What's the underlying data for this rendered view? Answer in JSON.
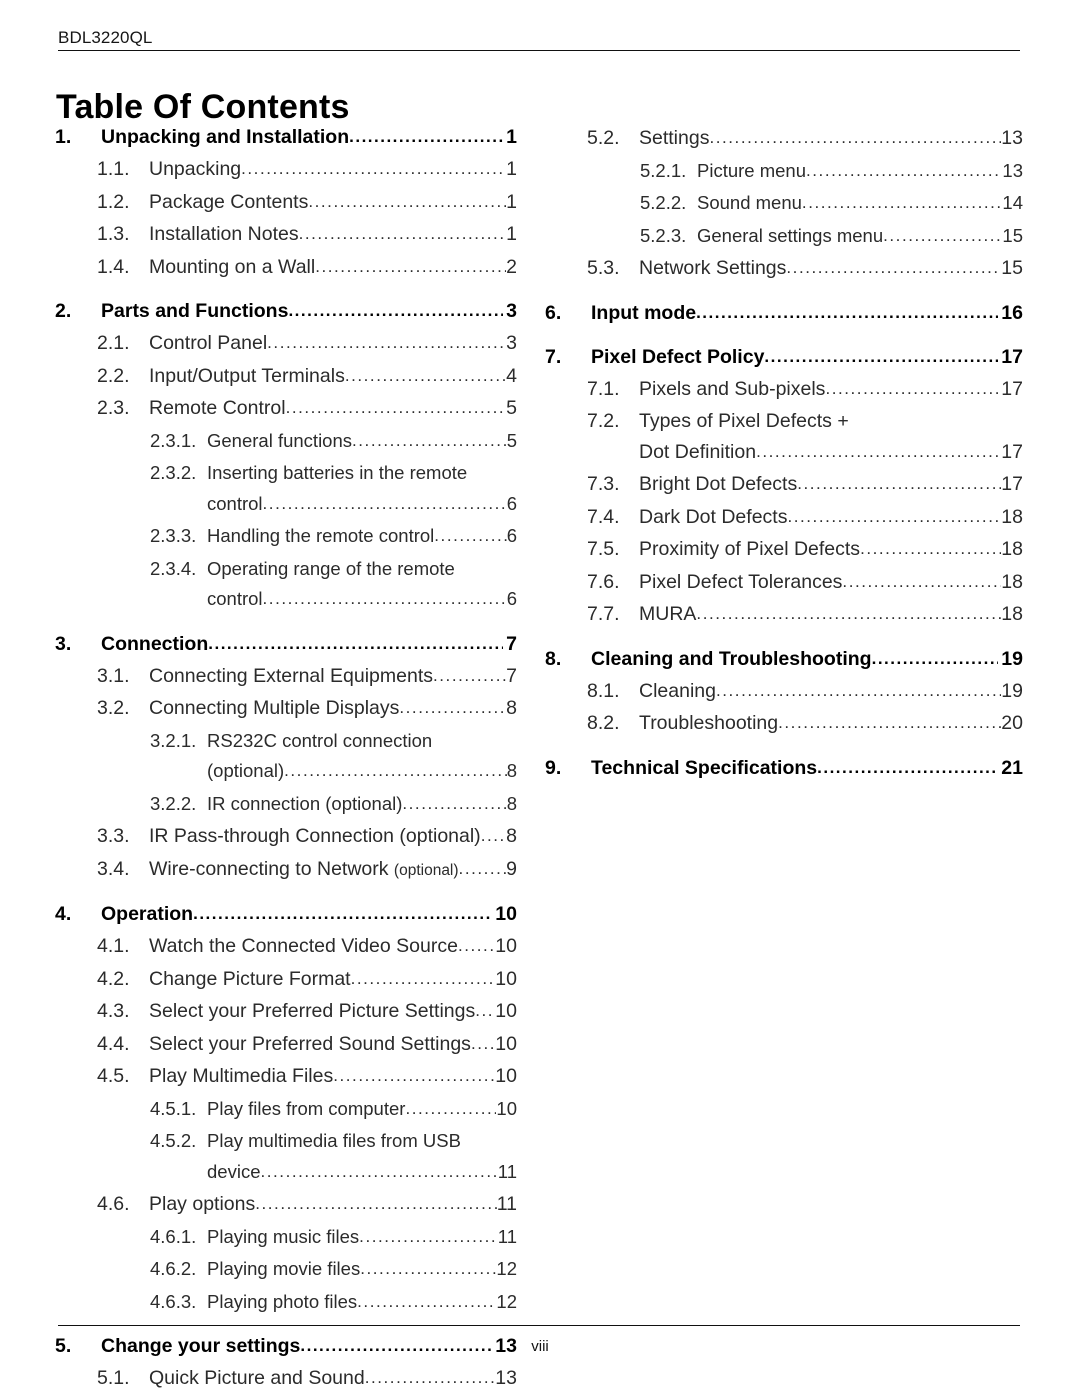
{
  "header": {
    "model": "BDL3220QL"
  },
  "title": "Table Of Contents",
  "footer": {
    "page_number": "viii"
  },
  "leader_dots": "................................................................................................................................",
  "columns": {
    "left": [
      {
        "level": 1,
        "number": "1.",
        "title": "Unpacking and Installation",
        "page": "1"
      },
      {
        "level": 2,
        "number": "1.1.",
        "title": "Unpacking",
        "page": "1"
      },
      {
        "level": 2,
        "number": "1.2.",
        "title": "Package Contents",
        "page": "1"
      },
      {
        "level": 2,
        "number": "1.3.",
        "title": "Installation Notes",
        "page": "1"
      },
      {
        "level": 2,
        "number": "1.4.",
        "title": "Mounting on a Wall",
        "page": "2"
      },
      {
        "level": 1,
        "number": "2.",
        "title": "Parts and Functions",
        "page": "3"
      },
      {
        "level": 2,
        "number": "2.1.",
        "title": "Control Panel",
        "page": "3"
      },
      {
        "level": 2,
        "number": "2.2.",
        "title": "Input/Output Terminals",
        "page": "4"
      },
      {
        "level": 2,
        "number": "2.3.",
        "title": "Remote Control",
        "page": "5"
      },
      {
        "level": 3,
        "number": "2.3.1.",
        "title": "General functions",
        "page": "5"
      },
      {
        "level": 3,
        "number": "2.3.2.",
        "title": "Inserting batteries in the remote",
        "title2": "control",
        "page": "6"
      },
      {
        "level": 3,
        "number": "2.3.3.",
        "title": "Handling the remote control",
        "page": "6"
      },
      {
        "level": 3,
        "number": "2.3.4.",
        "title": "Operating range of the remote",
        "title2": "control",
        "page": "6"
      },
      {
        "level": 1,
        "number": "3.",
        "title": "Connection",
        "page": "7"
      },
      {
        "level": 2,
        "number": "3.1.",
        "title": "Connecting External Equipments",
        "page": "7"
      },
      {
        "level": 2,
        "number": "3.2.",
        "title": "Connecting Multiple Displays",
        "page": "8"
      },
      {
        "level": 3,
        "number": "3.2.1.",
        "title": "RS232C control connection",
        "title2": "(optional)",
        "page": "8"
      },
      {
        "level": 3,
        "number": "3.2.2.",
        "title": "IR connection (optional)",
        "page": "8"
      },
      {
        "level": 2,
        "number": "3.3.",
        "title": "IR Pass-through Connection (optional)",
        "page": "8"
      },
      {
        "level": 2,
        "number": "3.4.",
        "title": "Wire-connecting to Network ",
        "note": "(optional)",
        "page": "9"
      },
      {
        "level": 1,
        "number": "4.",
        "title": "Operation",
        "page": "10"
      },
      {
        "level": 2,
        "number": "4.1.",
        "title": "Watch the Connected Video Source",
        "page": "10"
      },
      {
        "level": 2,
        "number": "4.2.",
        "title": "Change Picture Format",
        "page": "10"
      },
      {
        "level": 2,
        "number": "4.3.",
        "title": "Select your Preferred Picture Settings",
        "page": "10"
      },
      {
        "level": 2,
        "number": "4.4.",
        "title": "Select your Preferred Sound Settings",
        "page": "10"
      },
      {
        "level": 2,
        "number": "4.5.",
        "title": "Play Multimedia Files",
        "page": "10"
      },
      {
        "level": 3,
        "number": "4.5.1.",
        "title": "Play files from computer",
        "page": "10"
      },
      {
        "level": 3,
        "number": "4.5.2.",
        "title": "Play multimedia files from USB",
        "title2": "device",
        "page": "11"
      },
      {
        "level": 2,
        "number": "4.6.",
        "title": "Play options",
        "page": "11"
      },
      {
        "level": 3,
        "number": "4.6.1.",
        "title": "Playing music files",
        "page": "11"
      },
      {
        "level": 3,
        "number": "4.6.2.",
        "title": "Playing movie files",
        "page": "12"
      },
      {
        "level": 3,
        "number": "4.6.3.",
        "title": "Playing photo files",
        "page": "12"
      },
      {
        "level": 1,
        "number": "5.",
        "title": "Change your settings",
        "page": "13"
      },
      {
        "level": 2,
        "number": "5.1.",
        "title": "Quick Picture and Sound",
        "page": "13"
      }
    ],
    "right": [
      {
        "level": 2,
        "number": "5.2.",
        "title": "Settings",
        "page": "13"
      },
      {
        "level": 3,
        "number": "5.2.1.",
        "title": "Picture menu",
        "page": "13"
      },
      {
        "level": 3,
        "number": "5.2.2.",
        "title": "Sound menu",
        "page": "14"
      },
      {
        "level": 3,
        "number": "5.2.3.",
        "title": "General settings menu",
        "page": "15"
      },
      {
        "level": 2,
        "number": "5.3.",
        "title": "Network Settings",
        "page": "15"
      },
      {
        "level": 1,
        "number": "6.",
        "title": "Input mode",
        "page": "16"
      },
      {
        "level": 1,
        "number": "7.",
        "title": "Pixel Defect Policy",
        "page": "17"
      },
      {
        "level": 2,
        "number": "7.1.",
        "title": "Pixels and Sub-pixels",
        "page": "17"
      },
      {
        "level": 2,
        "number": "7.2.",
        "title": "Types of Pixel Defects +",
        "title2": "Dot Definition",
        "page": "17"
      },
      {
        "level": 2,
        "number": "7.3.",
        "title": "Bright Dot Defects",
        "page": "17"
      },
      {
        "level": 2,
        "number": "7.4.",
        "title": "Dark Dot Defects",
        "page": "18"
      },
      {
        "level": 2,
        "number": "7.5.",
        "title": "Proximity of Pixel Defects",
        "page": "18"
      },
      {
        "level": 2,
        "number": "7.6.",
        "title": "Pixel Defect Tolerances",
        "page": "18"
      },
      {
        "level": 2,
        "number": "7.7.",
        "title": "MURA",
        "page": "18"
      },
      {
        "level": 1,
        "number": "8.",
        "title": "Cleaning and Troubleshooting",
        "page": "19"
      },
      {
        "level": 2,
        "number": "8.1.",
        "title": "Cleaning",
        "page": "19"
      },
      {
        "level": 2,
        "number": "8.2.",
        "title": "Troubleshooting",
        "page": "20"
      },
      {
        "level": 1,
        "number": "9.",
        "title": "Technical Specifications",
        "page": "21"
      }
    ]
  }
}
